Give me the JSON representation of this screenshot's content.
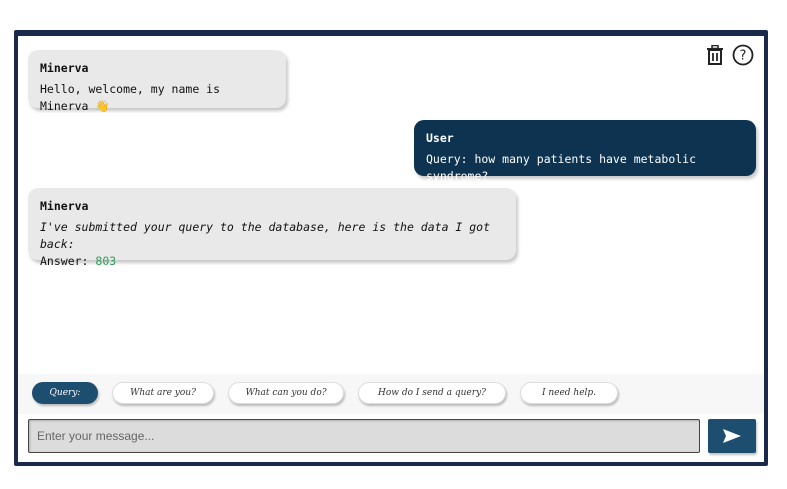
{
  "messages": [
    {
      "sender": "Minerva",
      "text": "Hello, welcome, my name is Minerva",
      "emoji": "👋"
    },
    {
      "sender": "User",
      "text": "Query: how many patients have metabolic syndrome?"
    },
    {
      "sender": "Minerva",
      "text": "I've submitted your query to the database, here is the data I got back:",
      "answer_label": "Answer:",
      "answer_value": "803"
    }
  ],
  "suggestions": [
    {
      "label": "Query:"
    },
    {
      "label": "What are you?"
    },
    {
      "label": "What can you do?"
    },
    {
      "label": "How do I send a query?"
    },
    {
      "label": "I need help."
    }
  ],
  "input": {
    "placeholder": "Enter your message...",
    "value": ""
  },
  "icons": {
    "delete": "trash-icon",
    "help": "help-circle-icon",
    "send": "send-arrow-icon"
  },
  "colors": {
    "primary": "#1d4e70",
    "user_bubble": "#0d3350",
    "bot_bubble": "#e9e9e9",
    "answer": "#2e9f57"
  }
}
